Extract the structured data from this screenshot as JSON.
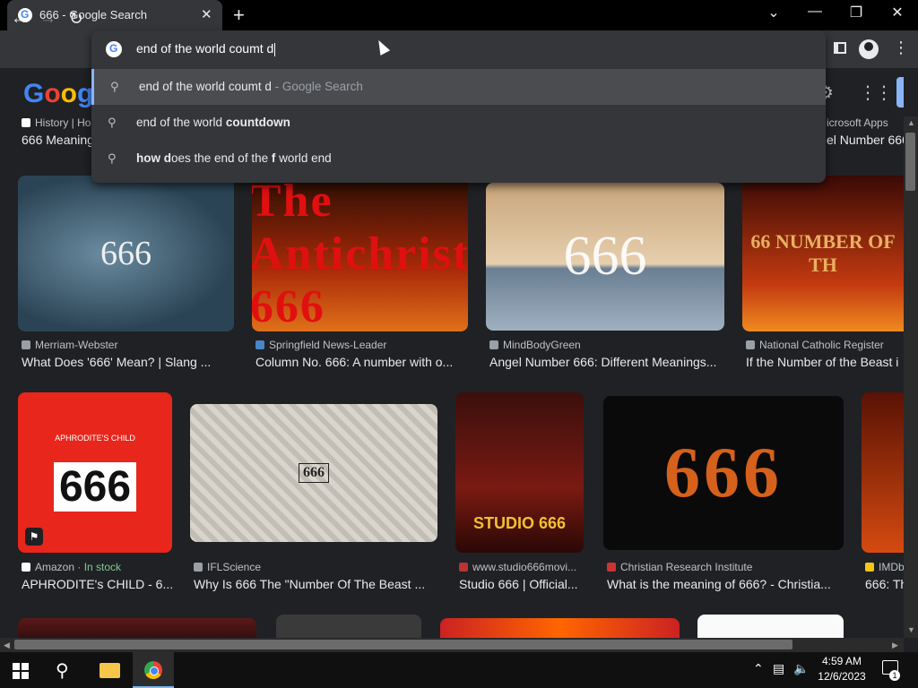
{
  "tab": {
    "title": "666 - Google Search",
    "close": "✕"
  },
  "window": {
    "minimize": "—",
    "restore": "❐",
    "close": "✕",
    "tabsearch": "⌄"
  },
  "omnibox": {
    "value": "end of the world coumt d",
    "suggestions": [
      {
        "pre": "end of the world coumt d",
        "bold": "",
        "post": "",
        "sub": " - Google Search",
        "selected": true
      },
      {
        "pre": "end of the world ",
        "bold": "countdown",
        "post": "",
        "sub": "",
        "selected": false
      },
      {
        "pre": "",
        "bold": "how d",
        "post": "oes the end of the ",
        "bold2": "f",
        "post2": " world end",
        "sub": ""
      }
    ]
  },
  "google_logo": [
    "G",
    "o",
    "o",
    "g",
    "l",
    "e"
  ],
  "row0": [
    {
      "source": "History | Ho",
      "caption": "666 Meaning"
    },
    {
      "source": "icrosoft Apps",
      "caption": "el Number 666"
    }
  ],
  "row1": [
    {
      "source": "Merriam-Webster",
      "caption": "What Does '666' Mean? | Slang ...",
      "thumb_text": "666"
    },
    {
      "source": "Springfield News-Leader",
      "caption": "Column No. 666: A number with o...",
      "thumb_text": "The Antichrist 666"
    },
    {
      "source": "MindBodyGreen",
      "caption": "Angel Number 666: Different Meanings...",
      "thumb_text": "666"
    },
    {
      "source": "National Catholic Register",
      "caption": "If the Number of the Beast i",
      "thumb_text": "66 NUMBER OF TH"
    }
  ],
  "row2": [
    {
      "source": "Amazon",
      "stock": " · In stock",
      "caption": "APHRODITE's CHILD - 6...",
      "thumb_text": "666",
      "thumb_top": "APHRODITE'S CHILD"
    },
    {
      "source": "IFLScience",
      "caption": "Why Is 666 The \"Number Of The Beast ...",
      "thumb_text": "666"
    },
    {
      "source": "www.studio666movi...",
      "caption": "Studio 666 | Official...",
      "thumb_text": "STUDIO 666"
    },
    {
      "source": "Christian Research Institute",
      "caption": "What is the meaning of 666? - Christia...",
      "thumb_text": "666"
    },
    {
      "source": "IMDb",
      "caption": "666: Th"
    }
  ],
  "taskbar": {
    "time": "4:59 AM",
    "date": "12/6/2023",
    "notifications": "1"
  }
}
